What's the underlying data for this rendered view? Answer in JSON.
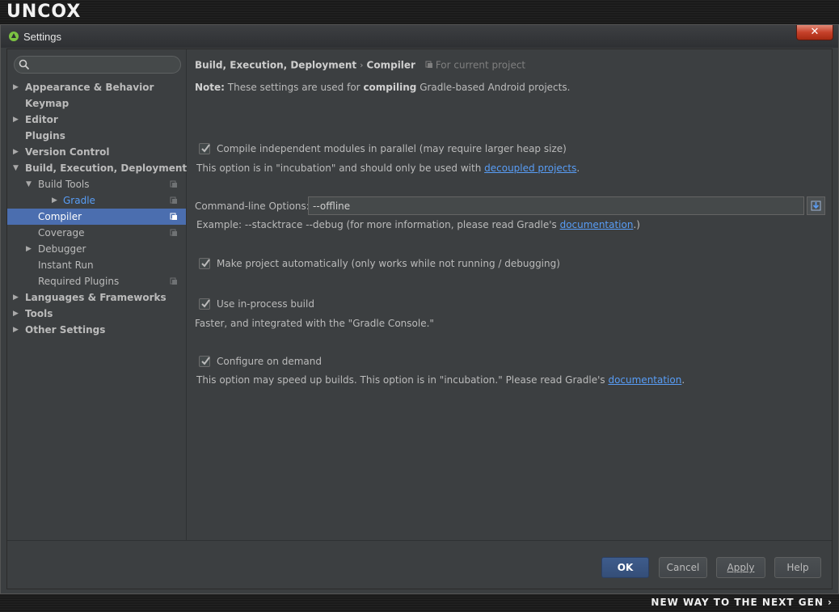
{
  "brand": {
    "logo": "UNCOX",
    "tagline": "NEW WAY TO THE NEXT GEN ›"
  },
  "window": {
    "title": "Settings",
    "close_label": "✕"
  },
  "search": {
    "value": "",
    "placeholder": ""
  },
  "tree": [
    {
      "label": "Appearance & Behavior",
      "level": 0,
      "arrow": "collapsed",
      "bold": true
    },
    {
      "label": "Keymap",
      "level": 0,
      "arrow": "none",
      "bold": true
    },
    {
      "label": "Editor",
      "level": 0,
      "arrow": "collapsed",
      "bold": true
    },
    {
      "label": "Plugins",
      "level": 0,
      "arrow": "none",
      "bold": true
    },
    {
      "label": "Version Control",
      "level": 0,
      "arrow": "collapsed",
      "bold": true
    },
    {
      "label": "Build, Execution, Deployment",
      "level": 0,
      "arrow": "expanded",
      "bold": true
    },
    {
      "label": "Build Tools",
      "level": 1,
      "arrow": "expanded",
      "project": true
    },
    {
      "label": "Gradle",
      "level": 2,
      "arrow": "collapsed",
      "project": true,
      "link": true
    },
    {
      "label": "Compiler",
      "level": 1,
      "arrow": "none",
      "project": true,
      "selected": true
    },
    {
      "label": "Coverage",
      "level": 1,
      "arrow": "none",
      "project": true
    },
    {
      "label": "Debugger",
      "level": 1,
      "arrow": "collapsed"
    },
    {
      "label": "Instant Run",
      "level": 1,
      "arrow": "none"
    },
    {
      "label": "Required Plugins",
      "level": 1,
      "arrow": "none",
      "project": true
    },
    {
      "label": "Languages & Frameworks",
      "level": 0,
      "arrow": "collapsed",
      "bold": true
    },
    {
      "label": "Tools",
      "level": 0,
      "arrow": "collapsed",
      "bold": true
    },
    {
      "label": "Other Settings",
      "level": 0,
      "arrow": "collapsed",
      "bold": true
    }
  ],
  "breadcrumb": {
    "section": "Build, Execution, Deployment",
    "separator": "›",
    "page": "Compiler",
    "scope": "For current project"
  },
  "note": {
    "prefix": "Note:",
    "text_before": " These settings are used for ",
    "emphasis": "compiling",
    "text_after": " Gradle-based Android projects."
  },
  "options": {
    "parallel": {
      "label": "Compile independent modules in parallel (may require larger heap size)",
      "checked": true,
      "hint_text": "This option is in \"incubation\" and should only be used with ",
      "hint_link": "decoupled projects",
      "hint_end": "."
    },
    "cmdline": {
      "label": "Command-line Options:",
      "value": "--offline",
      "hint_text": "Example: --stacktrace --debug (for more information, please read Gradle's ",
      "hint_link": "documentation",
      "hint_end": ".)"
    },
    "make_auto": {
      "label": "Make project automatically (only works while not running / debugging)",
      "checked": true
    },
    "in_process": {
      "label": "Use in-process build",
      "checked": true,
      "hint_text": "Faster, and integrated with the \"Gradle Console.\""
    },
    "on_demand": {
      "label": "Configure on demand",
      "checked": true,
      "hint_text": "This option may speed up builds. This option is in \"incubation.\" Please read Gradle's ",
      "hint_link": "documentation",
      "hint_end": "."
    }
  },
  "buttons": {
    "ok": "OK",
    "cancel": "Cancel",
    "apply": "Apply",
    "help": "Help"
  },
  "colors": {
    "selection": "#4b6eaf",
    "link": "#589df6",
    "background": "#3c3f41"
  }
}
